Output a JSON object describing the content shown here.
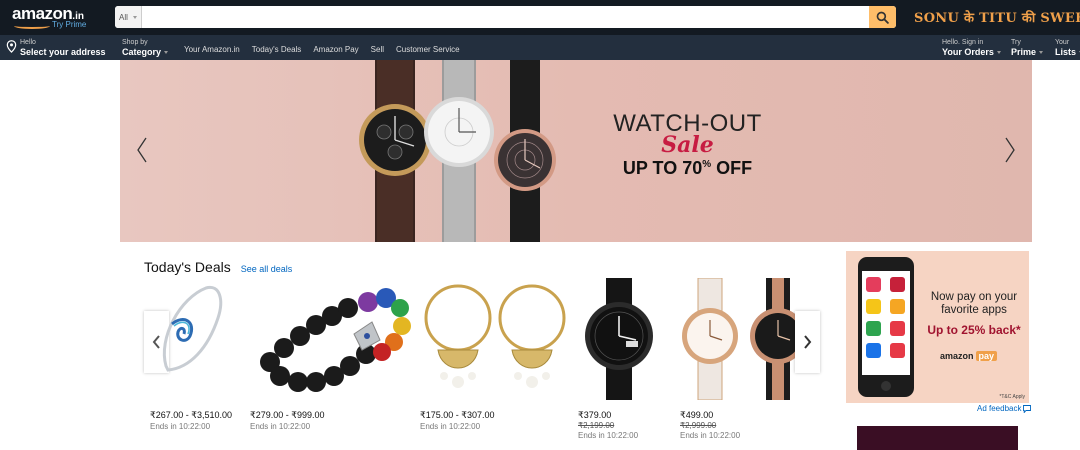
{
  "header": {
    "logo_word": "amazon",
    "logo_suffix": ".in",
    "logo_prime": "Try Prime",
    "search_category": "All",
    "search_placeholder": "",
    "promo_text": "SONU के TITU की SWEETY",
    "location_line1": "Hello",
    "location_line2": "Select your address",
    "shop_line1": "Shop by",
    "shop_line2": "Category",
    "nav_links": [
      "Your Amazon.in",
      "Today's Deals",
      "Amazon Pay",
      "Sell",
      "Customer Service"
    ],
    "orders_line1": "Hello. Sign in",
    "orders_line2": "Your Orders",
    "prime_line1": "Try",
    "prime_line2": "Prime",
    "lists_line1": "Your",
    "lists_line2": "Lists"
  },
  "hero": {
    "title": "WATCH-OUT",
    "sale": "Sale",
    "offer_prefix": "UP TO 70",
    "offer_pct": "%",
    "offer_suffix": " OFF"
  },
  "deals": {
    "title": "Today's Deals",
    "see_all": "See all deals",
    "items": [
      {
        "price": "₹267.00 - ₹3,510.00",
        "old_price": "",
        "ends": "Ends in 10:22:00"
      },
      {
        "price": "₹279.00 - ₹999.00",
        "old_price": "",
        "ends": "Ends in 10:22:00"
      },
      {
        "price": "₹175.00 - ₹307.00",
        "old_price": "",
        "ends": "Ends in 10:22:00"
      },
      {
        "price": "₹379.00",
        "old_price": "₹2,199.00",
        "ends": "Ends in 10:22:00"
      },
      {
        "price": "₹499.00",
        "old_price": "₹2,999.00",
        "ends": "Ends in 10:22:00"
      }
    ]
  },
  "side_ad": {
    "headline": "Now pay on your favorite apps",
    "offer": "Up to 25% back*",
    "brand": "amazon",
    "brand_pay": "pay",
    "tnc": "*T&C Apply",
    "feedback": "Ad feedback"
  },
  "colors": {
    "nav_top": "#131a22",
    "nav_bottom": "#232f3e",
    "search_button": "#febd69",
    "accent_orange": "#f0a04a",
    "sale_red": "#c71c42",
    "link_blue": "#0066c0"
  }
}
